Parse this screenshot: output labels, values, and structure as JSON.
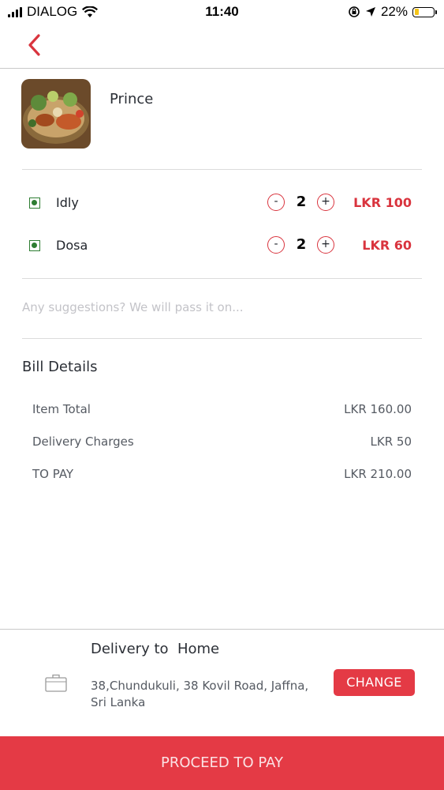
{
  "status_bar": {
    "carrier": "DIALOG",
    "time": "11:40",
    "battery_percent": "22%",
    "battery_level": 0.22,
    "icons": [
      "signal-icon",
      "wifi-icon",
      "orientation-lock-icon",
      "location-icon",
      "battery-icon"
    ]
  },
  "header": {
    "back_icon": "chevron-left-icon"
  },
  "restaurant": {
    "name": "Prince"
  },
  "cart": {
    "items": [
      {
        "name": "Idly",
        "minus": "-",
        "qty": "2",
        "plus": "+",
        "price": "LKR 100"
      },
      {
        "name": "Dosa",
        "minus": "-",
        "qty": "2",
        "plus": "+",
        "price": "LKR 60"
      }
    ]
  },
  "suggestions": {
    "placeholder": "Any suggestions? We will pass it on..."
  },
  "bill": {
    "title": "Bill Details",
    "rows": [
      {
        "label": "Item Total",
        "value": "LKR 160.00"
      },
      {
        "label": "Delivery Charges",
        "value": "LKR 50"
      },
      {
        "label": "TO PAY",
        "value": "LKR 210.00"
      }
    ]
  },
  "delivery": {
    "title": "Delivery to  Home",
    "address": "38,Chundukuli, 38 Kovil Road, Jaffna, Sri Lanka",
    "change_label": "CHANGE"
  },
  "proceed_label": "PROCEED TO PAY",
  "colors": {
    "accent": "#e43a45",
    "veg": "#2e7d32"
  }
}
